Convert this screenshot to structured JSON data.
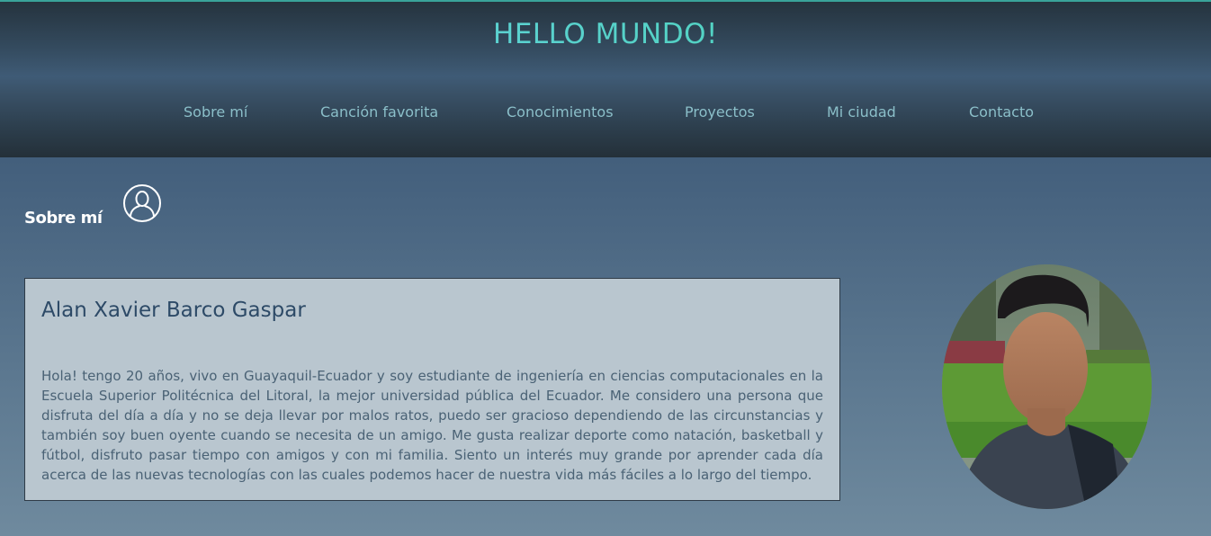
{
  "header": {
    "title": "HELLO MUNDO!",
    "nav": [
      {
        "label": "Sobre mí"
      },
      {
        "label": "Canción favorita"
      },
      {
        "label": "Conocimientos"
      },
      {
        "label": "Proyectos"
      },
      {
        "label": "Mi ciudad"
      },
      {
        "label": "Contacto"
      }
    ]
  },
  "about": {
    "section_title": "Sobre mí",
    "icon": "user-icon",
    "name": "Alan Xavier Barco Gaspar",
    "bio": "Hola! tengo 20 años, vivo en Guayaquil-Ecuador y soy estudiante de ingeniería en ciencias computacionales en la Escuela Superior Politécnica del Litoral, la mejor universidad pública del Ecuador. Me considero una persona que disfruta del día a día y no se deja llevar por malos ratos, puedo ser gracioso dependiendo de las circunstancias y también soy buen oyente cuando se necesita de un amigo. Me gusta realizar deporte como natación, basketball y fútbol, disfruto pasar tiempo con amigos y con mi familia. Siento un interés muy grande por aprender cada día acerca de las nuevas tecnologías con las cuales podemos hacer de nuestra vida más fáciles a lo largo del tiempo."
  },
  "colors": {
    "title_gradient_start": "#6fd0ee",
    "title_gradient_end": "#3fd4a6",
    "nav_link": "#8bbfc9",
    "card_bg": "#b9c6cf",
    "name_color": "#2d4a67"
  }
}
